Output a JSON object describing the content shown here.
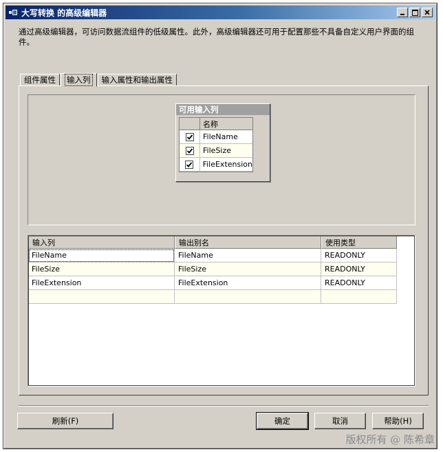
{
  "window": {
    "title": "大写转换 的高级编辑器",
    "icon": "component-icon"
  },
  "description": "通过高级编辑器，可访问数据流组件的低级属性。此外，高级编辑器还可用于配置那些不具备自定义用户界面的组件。",
  "tabs": [
    {
      "label": "组件属性"
    },
    {
      "label": "输入列",
      "active": true
    },
    {
      "label": "输入属性和输出属性"
    }
  ],
  "available_columns": {
    "title": "可用输入列",
    "header": "名称",
    "rows": [
      {
        "name": "FileName",
        "checked": true
      },
      {
        "name": "FileSize",
        "checked": true
      },
      {
        "name": "FileExtension",
        "checked": true
      }
    ]
  },
  "mapping_grid": {
    "headers": [
      "输入列",
      "输出别名",
      "使用类型"
    ],
    "rows": [
      [
        "FileName",
        "FileName",
        "READONLY"
      ],
      [
        "FileSize",
        "FileSize",
        "READONLY"
      ],
      [
        "FileExtension",
        "FileExtension",
        "READONLY"
      ]
    ]
  },
  "buttons": {
    "refresh": "刷新(F)",
    "ok": "确定",
    "cancel": "取消",
    "help": "帮助(H)"
  },
  "watermark": "版权所有 @ 陈希章",
  "colors": {
    "title_start": "#0a246a",
    "title_end": "#a6caf0",
    "dialog_face": "#d4d0c8",
    "alt_row": "#fffff0"
  }
}
